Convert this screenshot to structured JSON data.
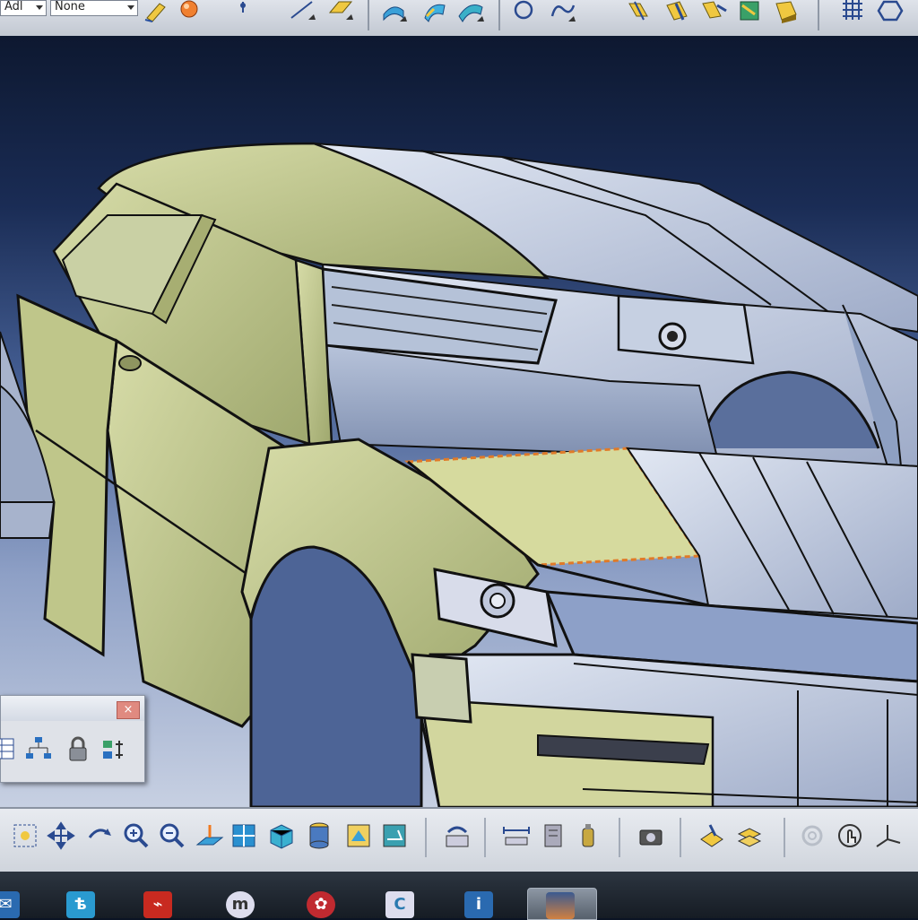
{
  "toolbar": {
    "layer_combo": "Adl",
    "filter_combo": "None",
    "icons": [
      "sketch-icon",
      "sphere-icon",
      "point-icon",
      "line-icon",
      "plane-icon",
      "extrude-surface-icon",
      "revolve-surface-icon",
      "sweep-surface-icon",
      "circle-icon",
      "spline-icon",
      "split-icon",
      "trim-icon",
      "join-icon",
      "heal-icon",
      "fillet-icon",
      "grid-icon",
      "hexagon-icon"
    ]
  },
  "floating_toolbar": {
    "close_glyph": "×",
    "icons": [
      "table-icon",
      "tree-icon",
      "lock-icon",
      "parameters-icon"
    ]
  },
  "bottom_toolbar": {
    "icons": [
      "fit-all-icon",
      "pan-icon",
      "rotate-icon",
      "zoom-in-icon",
      "zoom-out-icon",
      "normal-view-icon",
      "quick-view-icon",
      "isometric-icon",
      "shading-icon",
      "hide-show-icon",
      "swap-space-icon",
      "update-icon",
      "measure-icon",
      "measure-item-icon",
      "inertia-icon",
      "capture-icon",
      "apply-material-icon",
      "scene-icon",
      "render-icon",
      "touch-icon",
      "axis-icon"
    ]
  },
  "taskbar": {
    "apps": [
      "mail-icon",
      "catia-icon",
      "pdf-reader-icon",
      "media-icon",
      "record-icon",
      "launcher-icon",
      "info-icon",
      "viewer-icon"
    ]
  },
  "colors": {
    "surface_green": "#c9d29a",
    "surface_blue": "#c8d3e6",
    "background_dark": "#0d1830",
    "highlight_orange": "#e07a28"
  }
}
